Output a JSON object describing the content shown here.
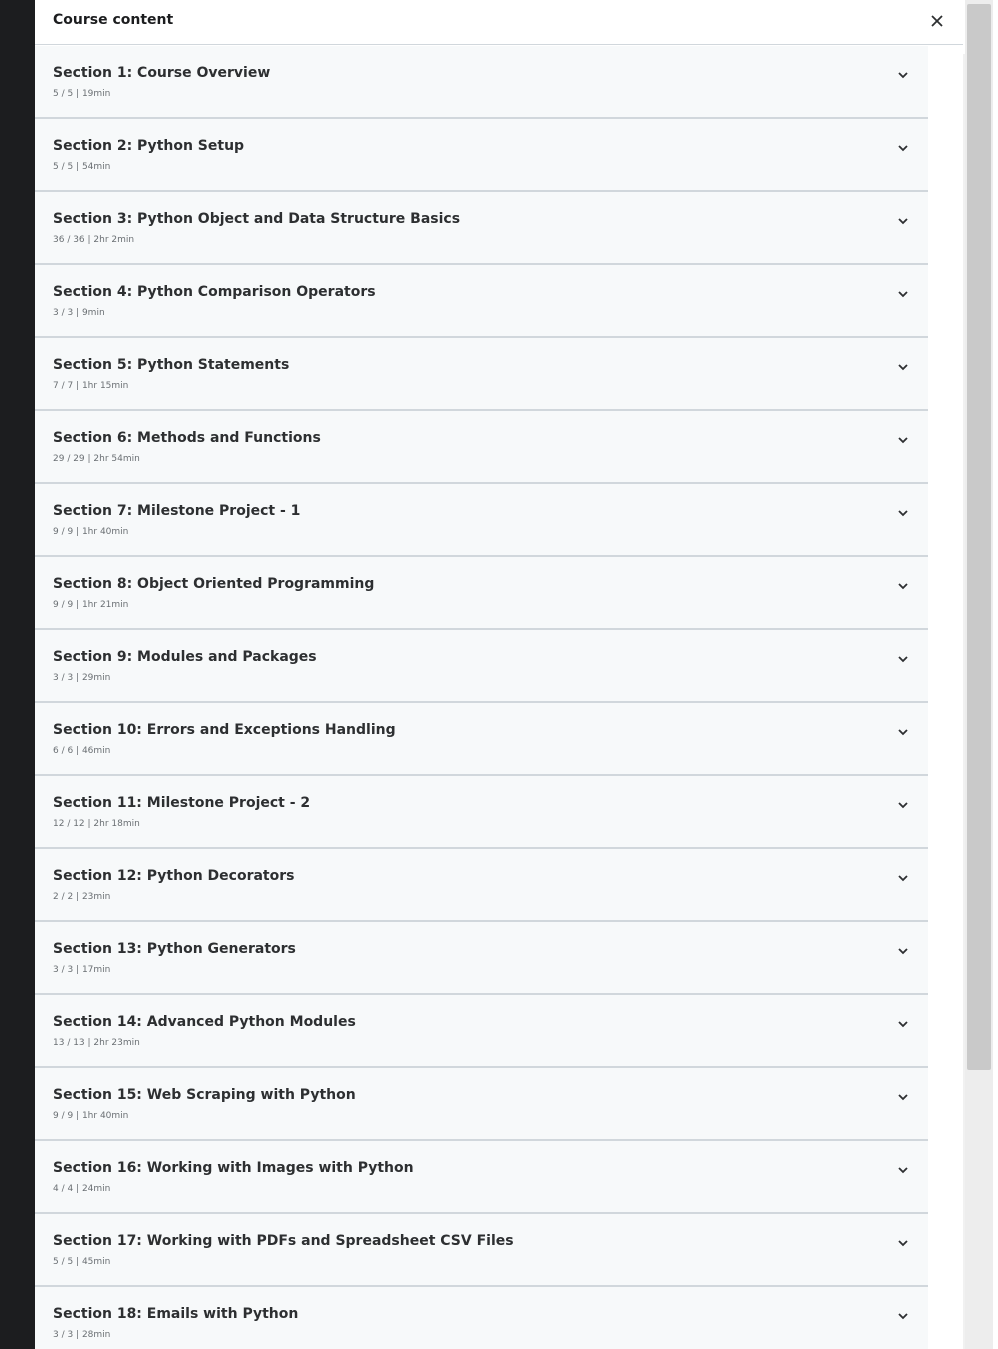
{
  "panel": {
    "title": "Course content"
  },
  "icons": {
    "close": "close-icon",
    "expand": "chevron-down-icon",
    "scroll_up": "triangle-up-icon"
  },
  "colors": {
    "sidebar_dark": "#1c1d1f",
    "section_bg": "#f7f9fa",
    "divider": "#d1d7dc",
    "title_text": "#2d2f31",
    "meta_text": "#6a6f73"
  },
  "sections": [
    {
      "title": "Section 1: Course Overview",
      "meta": "5 / 5 | 19min"
    },
    {
      "title": "Section 2: Python Setup",
      "meta": "5 / 5 | 54min"
    },
    {
      "title": "Section 3: Python Object and Data Structure Basics",
      "meta": "36 / 36 | 2hr 2min"
    },
    {
      "title": "Section 4: Python Comparison Operators",
      "meta": "3 / 3 | 9min"
    },
    {
      "title": "Section 5: Python Statements",
      "meta": "7 / 7 | 1hr 15min"
    },
    {
      "title": "Section 6: Methods and Functions",
      "meta": "29 / 29 | 2hr 54min"
    },
    {
      "title": "Section 7: Milestone Project - 1",
      "meta": "9 / 9 | 1hr 40min"
    },
    {
      "title": "Section 8: Object Oriented Programming",
      "meta": "9 / 9 | 1hr 21min"
    },
    {
      "title": "Section 9: Modules and Packages",
      "meta": "3 / 3 | 29min"
    },
    {
      "title": "Section 10: Errors and Exceptions Handling",
      "meta": "6 / 6 | 46min"
    },
    {
      "title": "Section 11: Milestone Project - 2",
      "meta": "12 / 12 | 2hr 18min"
    },
    {
      "title": "Section 12: Python Decorators",
      "meta": "2 / 2 | 23min"
    },
    {
      "title": "Section 13: Python Generators",
      "meta": "3 / 3 | 17min"
    },
    {
      "title": "Section 14: Advanced Python Modules",
      "meta": "13 / 13 | 2hr 23min"
    },
    {
      "title": "Section 15: Web Scraping with Python",
      "meta": "9 / 9 | 1hr 40min"
    },
    {
      "title": "Section 16: Working with Images with Python",
      "meta": "4 / 4 | 24min"
    },
    {
      "title": "Section 17: Working with PDFs and Spreadsheet CSV Files",
      "meta": "5 / 5 | 45min"
    },
    {
      "title": "Section 18: Emails with Python",
      "meta": "3 / 3 | 28min"
    }
  ]
}
